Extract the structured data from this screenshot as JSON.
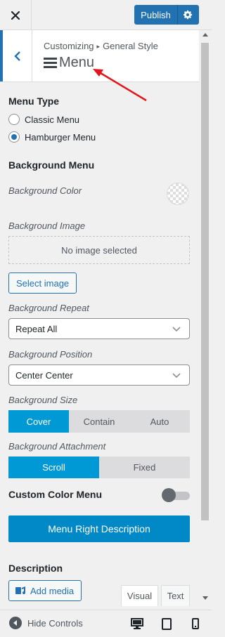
{
  "topbar": {
    "close_icon": "close-icon",
    "publish_label": "Publish",
    "settings_icon": "gear-icon"
  },
  "header": {
    "breadcrumb_parent": "Customizing",
    "breadcrumb_separator": "▸",
    "breadcrumb_child": "General Style",
    "title": "Menu",
    "back_icon": "chevron-left-icon",
    "title_icon": "hamburger-icon"
  },
  "menu_type": {
    "label": "Menu Type",
    "options": [
      "Classic Menu",
      "Hamburger Menu"
    ],
    "selected": "Hamburger Menu"
  },
  "background_menu": {
    "heading": "Background Menu",
    "color_label": "Background Color",
    "image_label": "Background Image",
    "image_placeholder": "No image selected",
    "select_image_label": "Select image",
    "repeat_label": "Background Repeat",
    "repeat_value": "Repeat All",
    "position_label": "Background Position",
    "position_value": "Center Center",
    "size_label": "Background Size",
    "size_options": [
      "Cover",
      "Contain",
      "Auto"
    ],
    "size_selected": "Cover",
    "attachment_label": "Background Attachment",
    "attachment_options": [
      "Scroll",
      "Fixed"
    ],
    "attachment_selected": "Scroll"
  },
  "custom_color": {
    "label": "Custom Color Menu",
    "enabled": false
  },
  "menu_right_button_label": "Menu Right Description",
  "description": {
    "label": "Description",
    "add_media_label": "Add media",
    "tabs": [
      "Visual",
      "Text"
    ],
    "active_tab": "Visual"
  },
  "footer": {
    "hide_controls_label": "Hide Controls",
    "devices": [
      "desktop-icon",
      "tablet-icon",
      "mobile-icon"
    ],
    "active_device": "desktop-icon"
  },
  "colors": {
    "accent": "#2271b1",
    "segment_active": "#0099d6",
    "primary_button": "#0088c7",
    "annotation_arrow": "#e3161b"
  }
}
